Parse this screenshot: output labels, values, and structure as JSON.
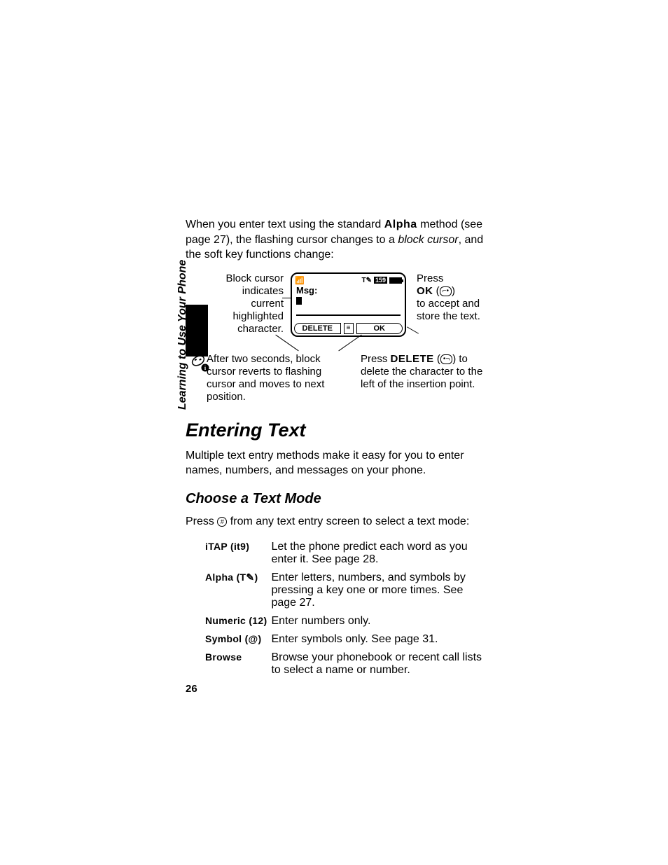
{
  "intro": {
    "pre": "When you enter text using the standard ",
    "alpha": "Alpha",
    "mid": " method (see page 27), the flashing cursor changes to a ",
    "block_cursor": "block cursor",
    "post": ", and the soft key functions change:"
  },
  "figure": {
    "left_top": "Block cursor indicates current highlighted character.",
    "right_top_pre": "Press ",
    "right_top_ok": "OK",
    "right_top_post": " to accept and store the text.",
    "left_bot": "After two seconds, block cursor reverts to flashing cursor and moves to next position.",
    "right_bot_pre": "Press ",
    "right_bot_del": "DELETE",
    "right_bot_post": " to delete the character to the left of the insertion point.",
    "screen": {
      "msg_label": "Msg:",
      "count": "159",
      "delete": "DELETE",
      "ok": "OK",
      "menu_glyph": "≡"
    }
  },
  "h1": "Entering Text",
  "para": "Multiple text entry methods make it easy for you to enter names, numbers, and messages on your phone.",
  "h2": "Choose a Text Mode",
  "press_pre": "Press ",
  "press_glyph": "#",
  "press_post": " from any text entry screen to select a text mode:",
  "modes": [
    {
      "name": "iTAP",
      "glyph": "(it9)",
      "desc": "Let the phone predict each word as you enter it. See page 28."
    },
    {
      "name": "Alpha",
      "glyph": "(T✎)",
      "desc": "Enter letters, numbers, and symbols by pressing a key one or more times. See page 27."
    },
    {
      "name": "Numeric",
      "glyph": "(12)",
      "desc": "Enter numbers only."
    },
    {
      "name": "Symbol",
      "glyph": "(@)",
      "desc": "Enter symbols only. See page 31."
    },
    {
      "name": "Browse",
      "glyph": "",
      "desc": "Browse your phonebook or recent call lists to select a name or number."
    }
  ],
  "sideways": "Learning to Use Your Phone",
  "pagenum": "26"
}
